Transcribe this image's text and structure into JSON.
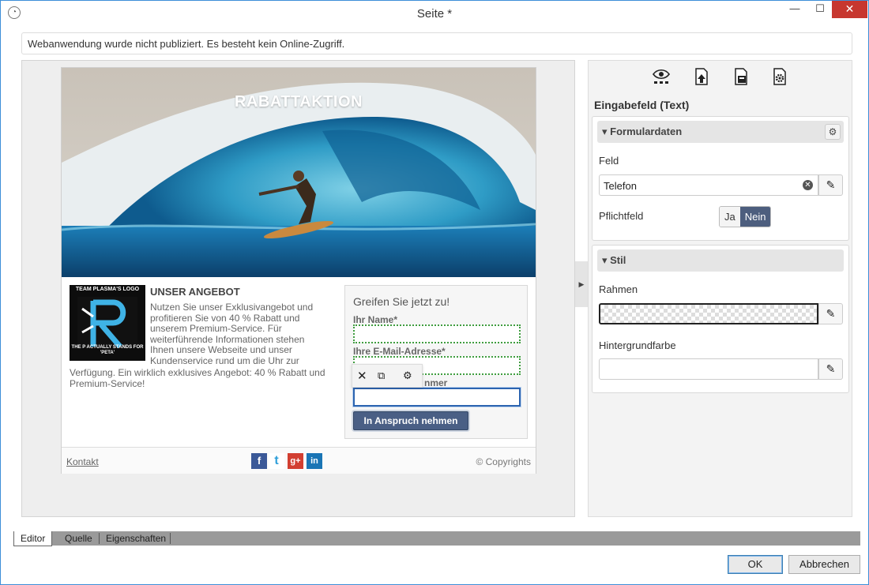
{
  "window": {
    "title": "Seite *",
    "minimize": "—",
    "maximize": "☐",
    "close": "✕"
  },
  "notice": "Webanwendung wurde nicht publiziert. Es besteht kein Online-Zugriff.",
  "page": {
    "hero_title": "RABATTAKTION",
    "logo_text_top": "TEAM PLASMA'S LOGO",
    "logo_text_bottom": "THE P ACTUALLY STANDS FOR 'PETA'",
    "offer_title": "UNSER ANGEBOT",
    "offer_text": "Nutzen Sie unser Exklusivangebot und profitieren Sie von 40 % Rabatt und unserem Premium-Service. Für weiterführende Informationen stehen Ihnen unsere Webseite und unser Kundenservice rund um die Uhr zur",
    "offer_text_cont": "Verfügung. Ein wirklich exklusives Angebot: 40 % Rabatt und Premium-Service!",
    "form": {
      "heading": "Greifen Sie jetzt zu!",
      "name_label": "Ihr Name*",
      "email_label": "Ihre E-Mail-Adresse*",
      "phone_label_partial": "nmer",
      "submit": "In Anspruch nehmen"
    },
    "footer": {
      "contact": "Kontakt",
      "copyright": "© Copyrights",
      "social": [
        "f",
        "t",
        "g+",
        "in"
      ]
    }
  },
  "panel": {
    "icons": [
      "eye-icon",
      "upload-icon",
      "save-icon",
      "settings-icon"
    ],
    "title": "Eingabefeld (Text)",
    "formulardaten": {
      "header": "Formulardaten",
      "feld_label": "Feld",
      "feld_value": "Telefon",
      "pflicht_label": "Pflichtfeld",
      "ja": "Ja",
      "nein": "Nein"
    },
    "stil": {
      "header": "Stil",
      "rahmen_label": "Rahmen",
      "hintergrund_label": "Hintergrundfarbe"
    }
  },
  "tabs": [
    "Editor",
    "Quelle",
    "Eigenschaften"
  ],
  "buttons": {
    "ok": "OK",
    "cancel": "Abbrechen"
  },
  "colors": {
    "accent": "#4d5e7e",
    "close": "#c7372f",
    "selection": "#2c64b0",
    "dashed": "#3f9d3f"
  }
}
